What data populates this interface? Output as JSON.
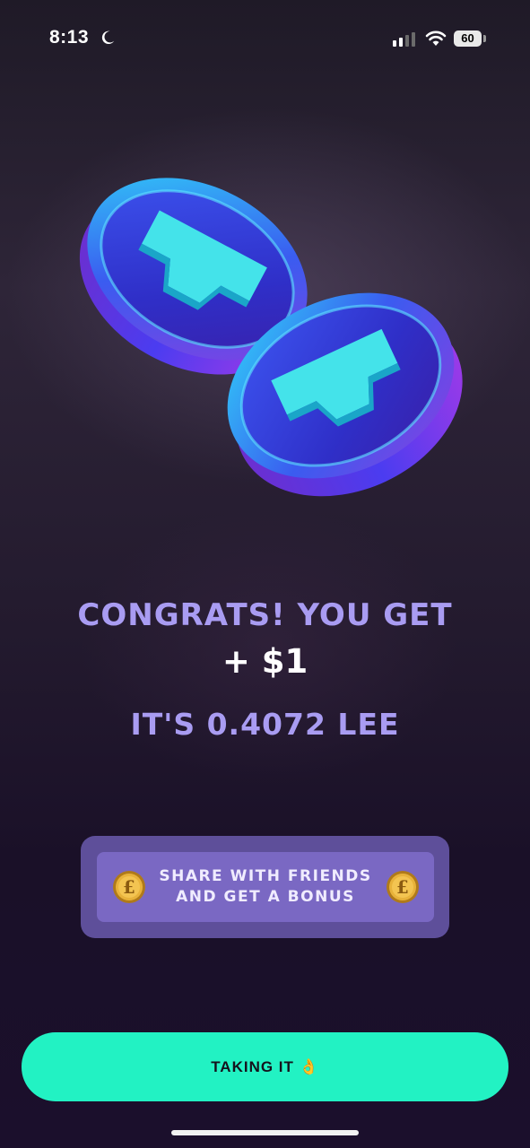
{
  "status_bar": {
    "time": "8:13",
    "battery": "60",
    "icons": [
      "moon-icon",
      "signal-icon",
      "wifi-icon",
      "battery-icon"
    ]
  },
  "hero": {
    "image": "two-coins-illustration"
  },
  "reward": {
    "headline": "CONGRATS! YOU GET",
    "amount": "+ $1",
    "conversion": "IT'S 0.4072 LEE"
  },
  "share": {
    "line1": "SHARE WITH FRIENDS",
    "line2": "AND GET A BONUS",
    "coin_icon": "£",
    "icons": [
      "coin-icon",
      "coin-icon"
    ]
  },
  "cta": {
    "label": "TAKING IT 👌"
  },
  "colors": {
    "accent_text": "#a99cf2",
    "cta_background": "#22f2c3",
    "share_background": "#7a68c3"
  }
}
